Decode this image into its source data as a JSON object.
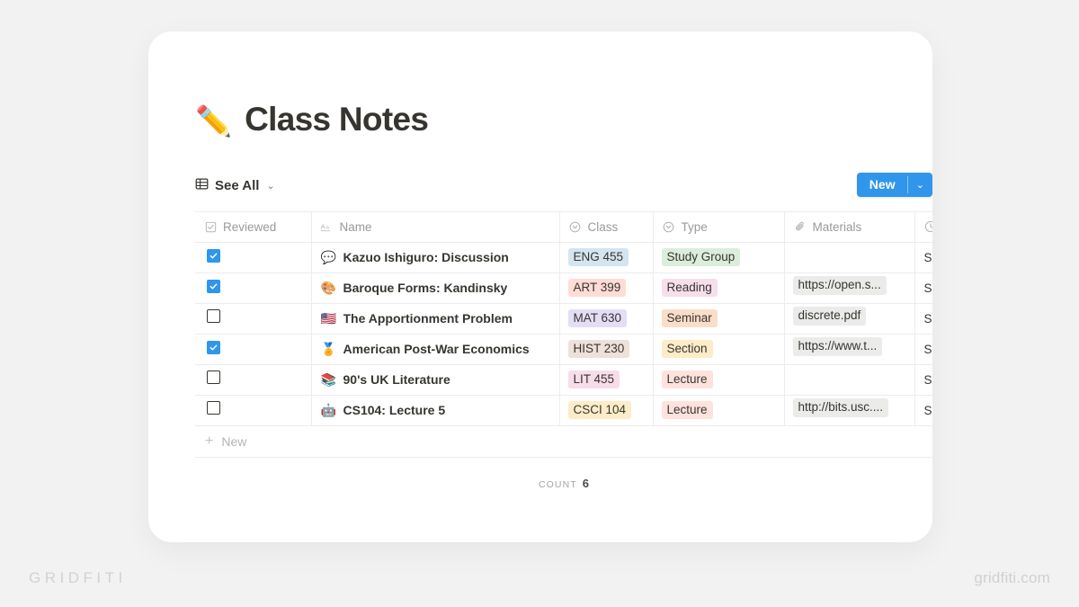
{
  "page": {
    "title": "Class Notes",
    "title_emoji": "✏️"
  },
  "view_bar": {
    "view_label": "See All",
    "view_chevron": "⌄",
    "table_icon": "table-icon",
    "new_button": {
      "label": "New",
      "chevron": "⌄",
      "color": "#2f96eb"
    }
  },
  "table": {
    "columns": [
      {
        "key": "reviewed",
        "label": "Reviewed",
        "icon": "checkbox-icon"
      },
      {
        "key": "name",
        "label": "Name",
        "icon": "text-aa-icon"
      },
      {
        "key": "class",
        "label": "Class",
        "icon": "select-icon"
      },
      {
        "key": "type",
        "label": "Type",
        "icon": "select-icon"
      },
      {
        "key": "materials",
        "label": "Materials",
        "icon": "paperclip-icon"
      },
      {
        "key": "when",
        "label": "",
        "icon": "clock-icon"
      }
    ],
    "rows": [
      {
        "reviewed": true,
        "emoji": "💬",
        "name": "Kazuo Ishiguro: Discussion",
        "class": "ENG 455",
        "class_bg": "#d3e5ef",
        "type": "Study Group",
        "type_bg": "#dbeddb",
        "materials": "",
        "when": "Se"
      },
      {
        "reviewed": true,
        "emoji": "🎨",
        "name": "Baroque Forms: Kandinsky",
        "class": "ART 399",
        "class_bg": "#ffdcd6",
        "type": "Reading",
        "type_bg": "#f5dfeb",
        "materials": "https://open.s...",
        "when": "Se"
      },
      {
        "reviewed": false,
        "emoji": "🇺🇸",
        "name": "The Apportionment Problem",
        "class": "MAT 630",
        "class_bg": "#e4ddf6",
        "type": "Seminar",
        "type_bg": "#fadec9",
        "materials": "discrete.pdf",
        "when": "Se"
      },
      {
        "reviewed": true,
        "emoji": "🏅",
        "name": "American Post-War Economics",
        "class": "HIST 230",
        "class_bg": "#eee0da",
        "type": "Section",
        "type_bg": "#fdecc8",
        "materials": "https://www.t...",
        "when": "Se"
      },
      {
        "reviewed": false,
        "emoji": "📚",
        "name": "90's UK Literature",
        "class": "LIT 455",
        "class_bg": "#f7dcea",
        "type": "Lecture",
        "type_bg": "#ffe2dd",
        "materials": "",
        "when": "Se"
      },
      {
        "reviewed": false,
        "emoji": "🤖",
        "name": "CS104: Lecture 5",
        "class": "CSCI 104",
        "class_bg": "#fdecc8",
        "type": "Lecture",
        "type_bg": "#ffe2dd",
        "materials": "http://bits.usc....",
        "when": "Se"
      }
    ],
    "new_row_label": "New",
    "new_row_plus": "+"
  },
  "footer": {
    "count_label": "Count",
    "count_value": "6"
  },
  "watermarks": {
    "left": "GRIDFITI",
    "right": "gridfiti.com"
  }
}
